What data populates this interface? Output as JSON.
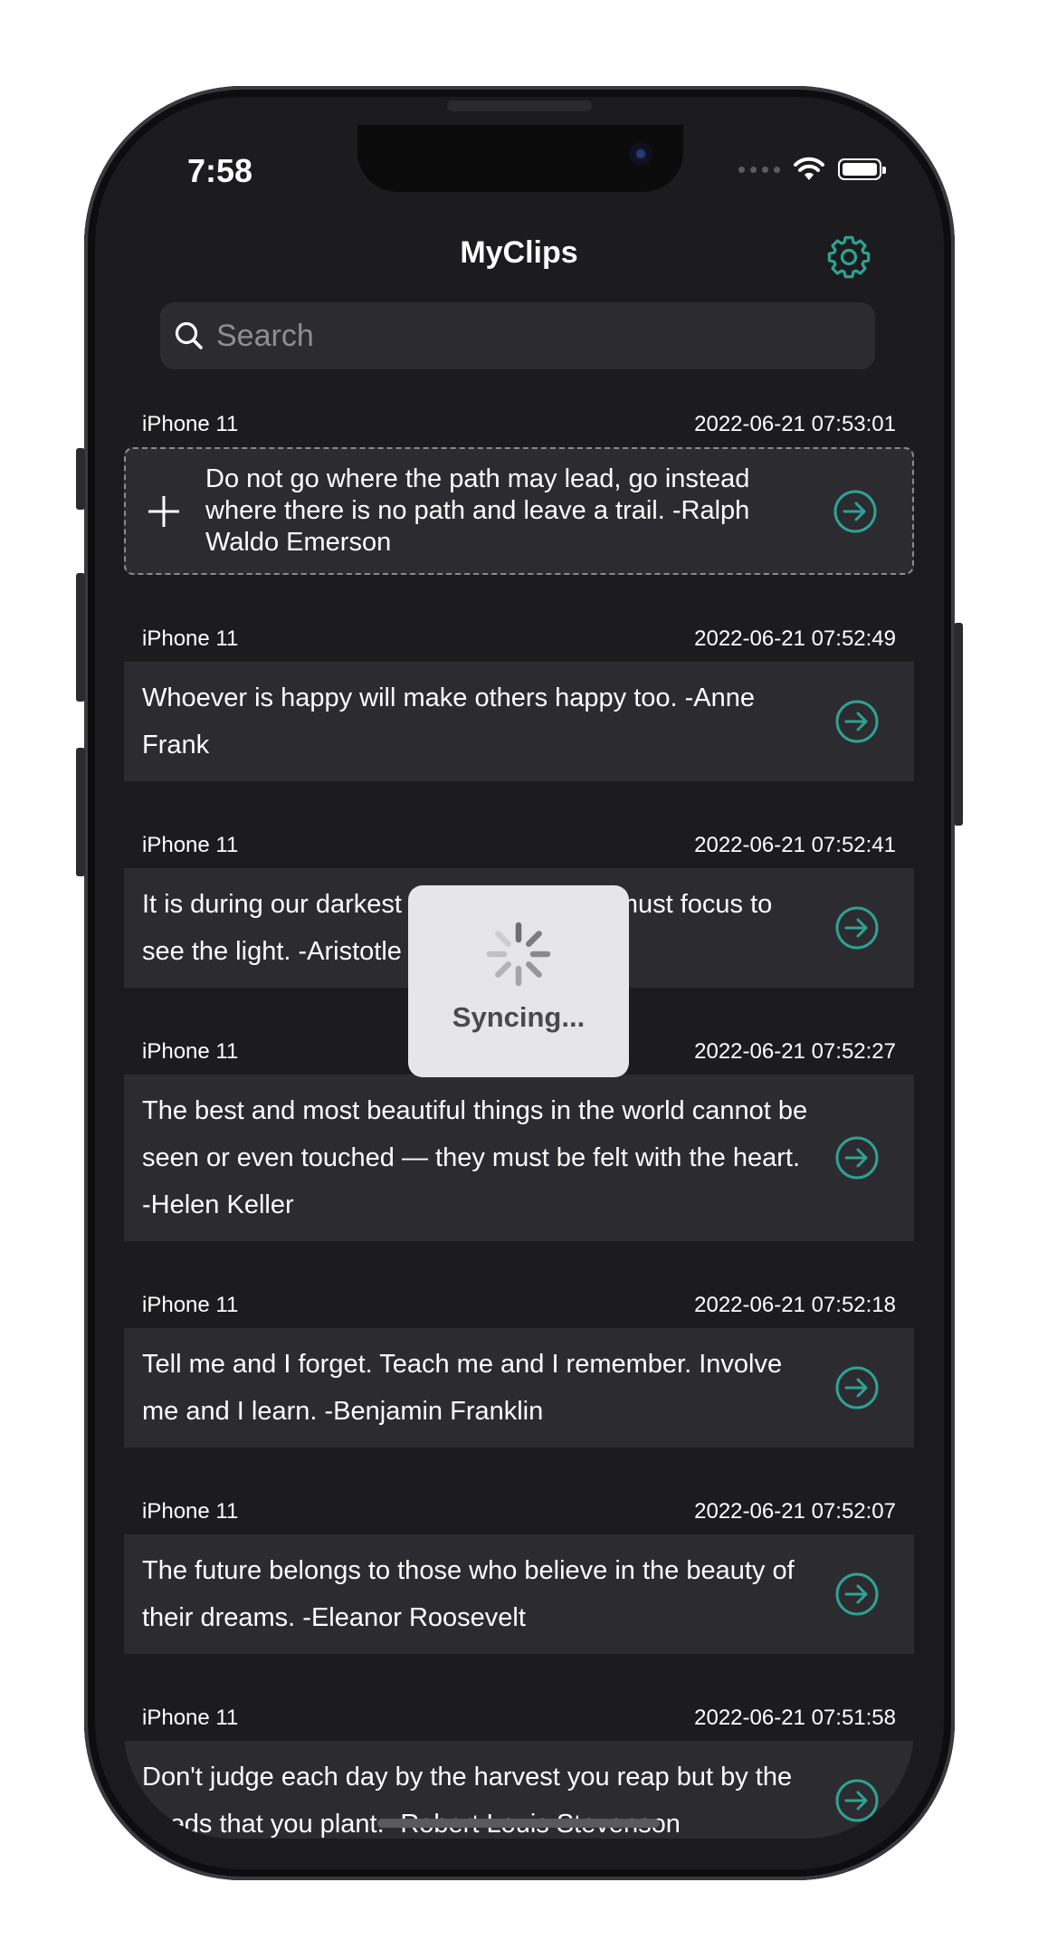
{
  "status": {
    "time": "7:58"
  },
  "nav": {
    "title": "MyClips"
  },
  "search": {
    "placeholder": "Search"
  },
  "clips": [
    {
      "device": "iPhone 11",
      "timestamp": "2022-06-21 07:53:01",
      "text": "Do not go where the path may lead, go instead where there is no path and leave a trail. -Ralph Waldo Emerson"
    },
    {
      "device": "iPhone 11",
      "timestamp": "2022-06-21 07:52:49",
      "text": "Whoever is happy will make others happy too. -Anne Frank"
    },
    {
      "device": "iPhone 11",
      "timestamp": "2022-06-21 07:52:41",
      "text": "It is during our darkest moments that we must focus to see the light. -Aristotle"
    },
    {
      "device": "iPhone 11",
      "timestamp": "2022-06-21 07:52:27",
      "text": "The best and most beautiful things in the world cannot be seen or even touched — they must be felt with the heart. -Helen Keller"
    },
    {
      "device": "iPhone 11",
      "timestamp": "2022-06-21 07:52:18",
      "text": "Tell me and I forget. Teach me and I remember. Involve me and I learn. -Benjamin Franklin"
    },
    {
      "device": "iPhone 11",
      "timestamp": "2022-06-21 07:52:07",
      "text": "The future belongs to those who believe in the beauty of their dreams. -Eleanor Roosevelt"
    },
    {
      "device": "iPhone 11",
      "timestamp": "2022-06-21 07:51:58",
      "text": "Don't judge each day by the harvest you reap but by the seeds that you plant. -Robert Louis Stevenson"
    }
  ],
  "hud": {
    "label": "Syncing..."
  },
  "colors": {
    "accent": "#2fa293",
    "background": "#1c1c1e",
    "cell": "#2c2c30",
    "hud": "#e6e6e8"
  },
  "icons": {
    "settings": "gear-icon",
    "search": "search-icon",
    "add": "plus-icon",
    "open": "arrow-circle-right-icon",
    "loading": "spinner-icon"
  }
}
